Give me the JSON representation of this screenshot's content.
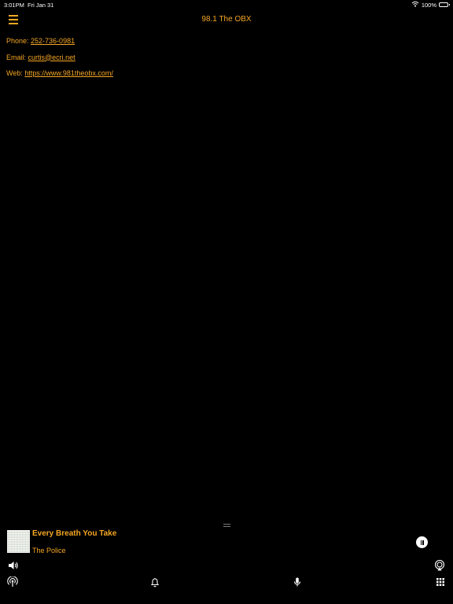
{
  "status_bar": {
    "time": "3:01PM",
    "date": "Fri Jan 31",
    "battery_text": "100%",
    "icons": [
      "wifi-icon",
      "battery-icon"
    ]
  },
  "header": {
    "title": "98.1 The OBX",
    "menu_icon": "hamburger-menu-icon"
  },
  "contact": {
    "phone_label": "Phone: ",
    "phone_value": "252-736-0981",
    "email_label": "Email: ",
    "email_value": "curtis@ecri.net",
    "web_label": "Web: ",
    "web_value": "https://www.981theobx.com/"
  },
  "player": {
    "track_title": "Every Breath You Take",
    "artist": "The Police",
    "state_icon": "pause-icon"
  },
  "toolbar": {
    "icons": [
      "volume-icon",
      "airplay-icon",
      "broadcast-icon",
      "bell-icon",
      "microphone-icon",
      "grid-icon"
    ]
  },
  "colors": {
    "accent": "#f5a623",
    "background": "#000000",
    "foreground": "#ffffff"
  }
}
